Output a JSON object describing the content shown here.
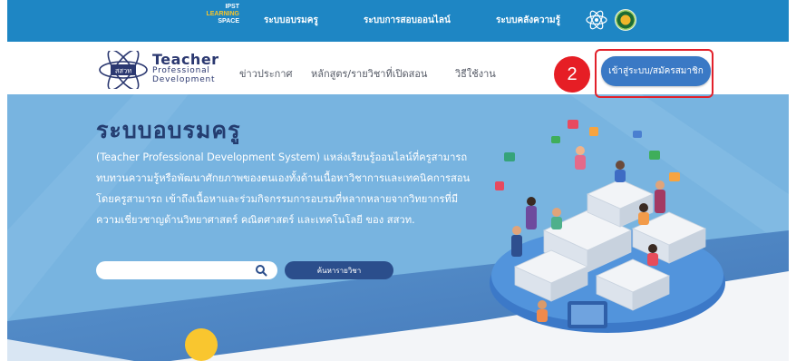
{
  "topbar": {
    "ipst_logo": [
      "IPST",
      "LEARNING",
      "SPACE"
    ],
    "nav": [
      "ระบบอบรมครู",
      "ระบบการสอบออนไลน์",
      "ระบบคลังความรู้"
    ],
    "icons": [
      "ipst-atom-logo-icon",
      "ministry-seal-icon"
    ]
  },
  "brand": {
    "logo_text": "สสวท",
    "line1": "Teacher",
    "line2": "Professional",
    "line3": "Development"
  },
  "subnav": {
    "news": "ข่าวประกาศ",
    "courses": "หลักสูตร/รายวิชาที่เปิดสอน",
    "howto": "วิธีใช้งาน",
    "login": "เข้าสู่ระบบ/สมัครสมาชิก"
  },
  "annotation": {
    "step": "2"
  },
  "hero": {
    "title": "ระบบอบรมครู",
    "description": "(Teacher Professional Development System) แหล่งเรียนรู้ออนไลน์ที่ครูสามารถ ทบทวนความรู้หรือพัฒนาศักยภาพของตนเองทั้งด้านเนื้อหาวิชาการและเทคนิคการสอน โดยครูสามารถ เข้าถึงเนื้อหาและร่วมกิจกรรมการอบรมที่หลากหลายจากวิทยากรที่มีความเชี่ยวชาญด้านวิทยาศาสตร์ คณิตศาสตร์ และเทคโนโลยี ของ สสวท.",
    "search_placeholder": "",
    "search_button": "ค้นหารายวิชา"
  },
  "colors": {
    "topbar": "#1e86c4",
    "hero_bg": "#78b4e0",
    "button_blue": "#3a79c5",
    "highlight_red": "#e2212b",
    "title_navy": "#243d70"
  }
}
